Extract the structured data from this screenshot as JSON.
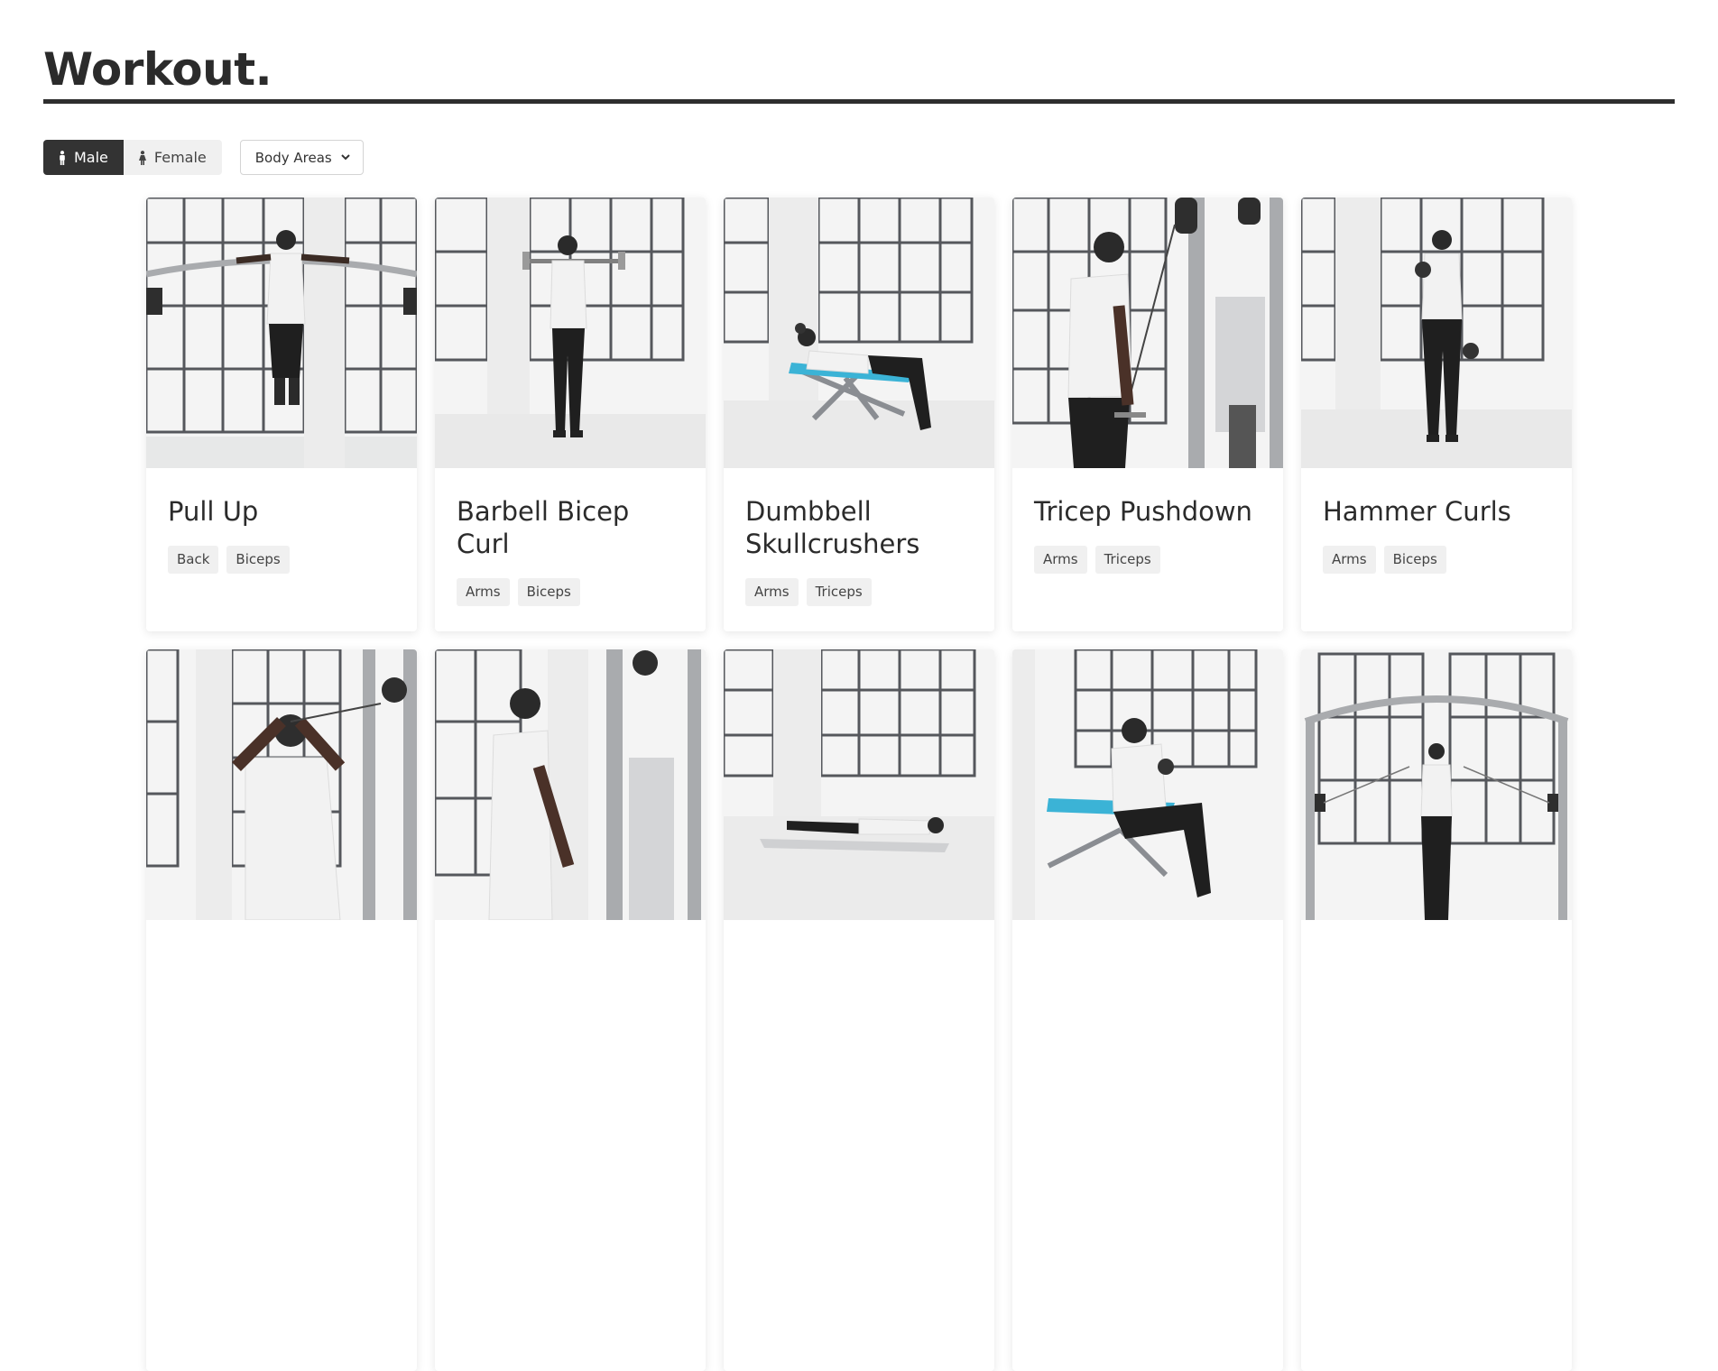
{
  "page": {
    "title": "Workout."
  },
  "filters": {
    "male_label": "Male",
    "female_label": "Female",
    "body_areas_label": "Body Areas"
  },
  "exercises": [
    {
      "name": "Pull Up",
      "tags": [
        "Back",
        "Biceps"
      ]
    },
    {
      "name": "Barbell Bicep Curl",
      "tags": [
        "Arms",
        "Biceps"
      ]
    },
    {
      "name": "Dumbbell Skullcrushers",
      "tags": [
        "Arms",
        "Triceps"
      ]
    },
    {
      "name": "Tricep Pushdown",
      "tags": [
        "Arms",
        "Triceps"
      ]
    },
    {
      "name": "Hammer Curls",
      "tags": [
        "Arms",
        "Biceps"
      ]
    }
  ],
  "colors": {
    "active_button": "#333333",
    "tag_background": "#f0f0f0",
    "bench_accent": "#3bb3d6"
  },
  "icons": {
    "male": "male-person-icon",
    "female": "female-person-icon",
    "dropdown": "chevron-down-icon"
  }
}
